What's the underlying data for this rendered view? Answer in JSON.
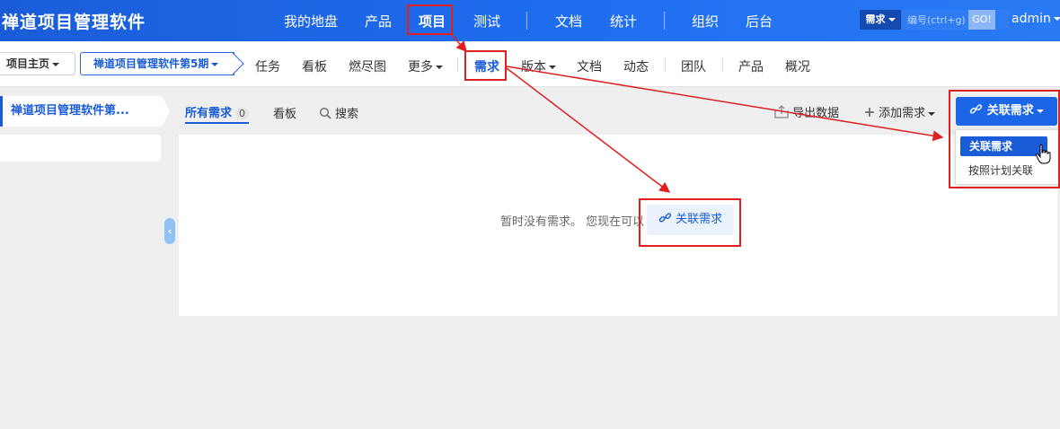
{
  "app": {
    "title": "禅道项目管理软件"
  },
  "main_nav": [
    {
      "label": "我的地盘"
    },
    {
      "label": "产品"
    },
    {
      "label": "项目"
    },
    {
      "label": "测试"
    },
    {
      "label": "文档"
    },
    {
      "label": "统计"
    },
    {
      "label": "组织"
    },
    {
      "label": "后台"
    }
  ],
  "search": {
    "type": "需求",
    "placeholder": "编号(ctrl+g)",
    "go": "GO!"
  },
  "user": {
    "name": "admin"
  },
  "breadcrumb": {
    "home": "项目主页",
    "project": "禅道项目管理软件第5期"
  },
  "sub_nav": [
    {
      "label": "任务"
    },
    {
      "label": "看板"
    },
    {
      "label": "燃尽图"
    },
    {
      "label": "更多"
    },
    {
      "label": "需求"
    },
    {
      "label": "版本"
    },
    {
      "label": "文档"
    },
    {
      "label": "动态"
    },
    {
      "label": "团队"
    },
    {
      "label": "产品"
    },
    {
      "label": "概况"
    }
  ],
  "left_panel": {
    "active_item": "禅道项目管理软件第..."
  },
  "toolbar": {
    "tab_all": "所有需求",
    "count": "0",
    "tab_board": "看板",
    "search": "搜索",
    "export": "导出数据",
    "add": "添加需求",
    "link_story": "关联需求"
  },
  "content": {
    "empty_text": "暂时没有需求。 您现在可以",
    "empty_link": "关联需求"
  },
  "dropdown": {
    "item1": "关联需求",
    "item2": "按照计划关联"
  },
  "colors": {
    "brand": "#1a5cd8",
    "highlight": "#e02020"
  }
}
